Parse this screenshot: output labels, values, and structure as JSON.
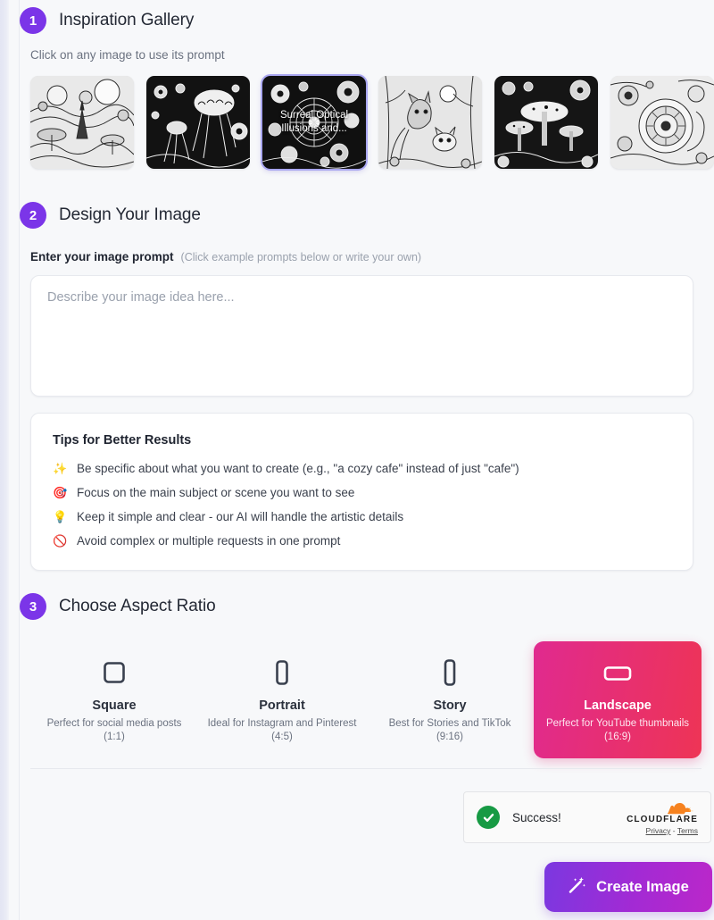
{
  "steps": {
    "gallery": {
      "number": "1",
      "title": "Inspiration Gallery",
      "subtitle": "Click on any image to use its prompt",
      "thumbnails": [
        {
          "alt": "surreal-fantasy-landscape",
          "caption": "",
          "selected": false
        },
        {
          "alt": "psychedelic-jellyfish",
          "caption": "",
          "selected": false
        },
        {
          "alt": "surreal-optical-mandala",
          "caption": "Surreal Optical Illusions and...",
          "selected": true
        },
        {
          "alt": "fox-in-moonlit-forest",
          "caption": "",
          "selected": false
        },
        {
          "alt": "psychedelic-mushrooms",
          "caption": "",
          "selected": false
        },
        {
          "alt": "ornate-spiral-swirls",
          "caption": "",
          "selected": false
        }
      ]
    },
    "design": {
      "number": "2",
      "title": "Design Your Image",
      "prompt_label": "Enter your image prompt",
      "prompt_hint": "(Click example prompts below or write your own)",
      "prompt_value": "",
      "prompt_placeholder": "Describe your image idea here...",
      "tips": {
        "title": "Tips for Better Results",
        "items": [
          {
            "emoji": "✨",
            "icon": "sparkles-icon",
            "text": "Be specific about what you want to create (e.g., \"a cozy cafe\" instead of just \"cafe\")"
          },
          {
            "emoji": "🎯",
            "icon": "target-icon",
            "text": "Focus on the main subject or scene you want to see"
          },
          {
            "emoji": "💡",
            "icon": "lightbulb-icon",
            "text": "Keep it simple and clear - our AI will handle the artistic details"
          },
          {
            "emoji": "🚫",
            "icon": "prohibited-icon",
            "text": "Avoid complex or multiple requests in one prompt"
          }
        ]
      }
    },
    "ratio": {
      "number": "3",
      "title": "Choose Aspect Ratio",
      "options": [
        {
          "name": "Square",
          "desc": "Perfect for social media posts (1:1)",
          "icon": "square-icon",
          "selected": false
        },
        {
          "name": "Portrait",
          "desc": "Ideal for Instagram and Pinterest (4:5)",
          "icon": "portrait-icon",
          "selected": false
        },
        {
          "name": "Story",
          "desc": "Best for Stories and TikTok (9:16)",
          "icon": "story-icon",
          "selected": false
        },
        {
          "name": "Landscape",
          "desc": "Perfect for YouTube thumbnails (16:9)",
          "icon": "landscape-icon",
          "selected": true
        }
      ]
    }
  },
  "turnstile": {
    "status": "Success!",
    "brand": "CLOUDFLARE",
    "privacy_label": "Privacy",
    "separator": "-",
    "terms_label": "Terms"
  },
  "submit": {
    "label": "Create Image",
    "icon": "magic-wand-icon"
  },
  "colors": {
    "step_badge": "#7b35e8",
    "selected_ratio_from": "#e02a8f",
    "selected_ratio_to": "#ee3455",
    "submit_from": "#7b38e0",
    "submit_to": "#bb27c9",
    "success_green": "#179a44",
    "cloudflare_orange": "#f6821f",
    "page_bg": "#f7f8fa"
  }
}
